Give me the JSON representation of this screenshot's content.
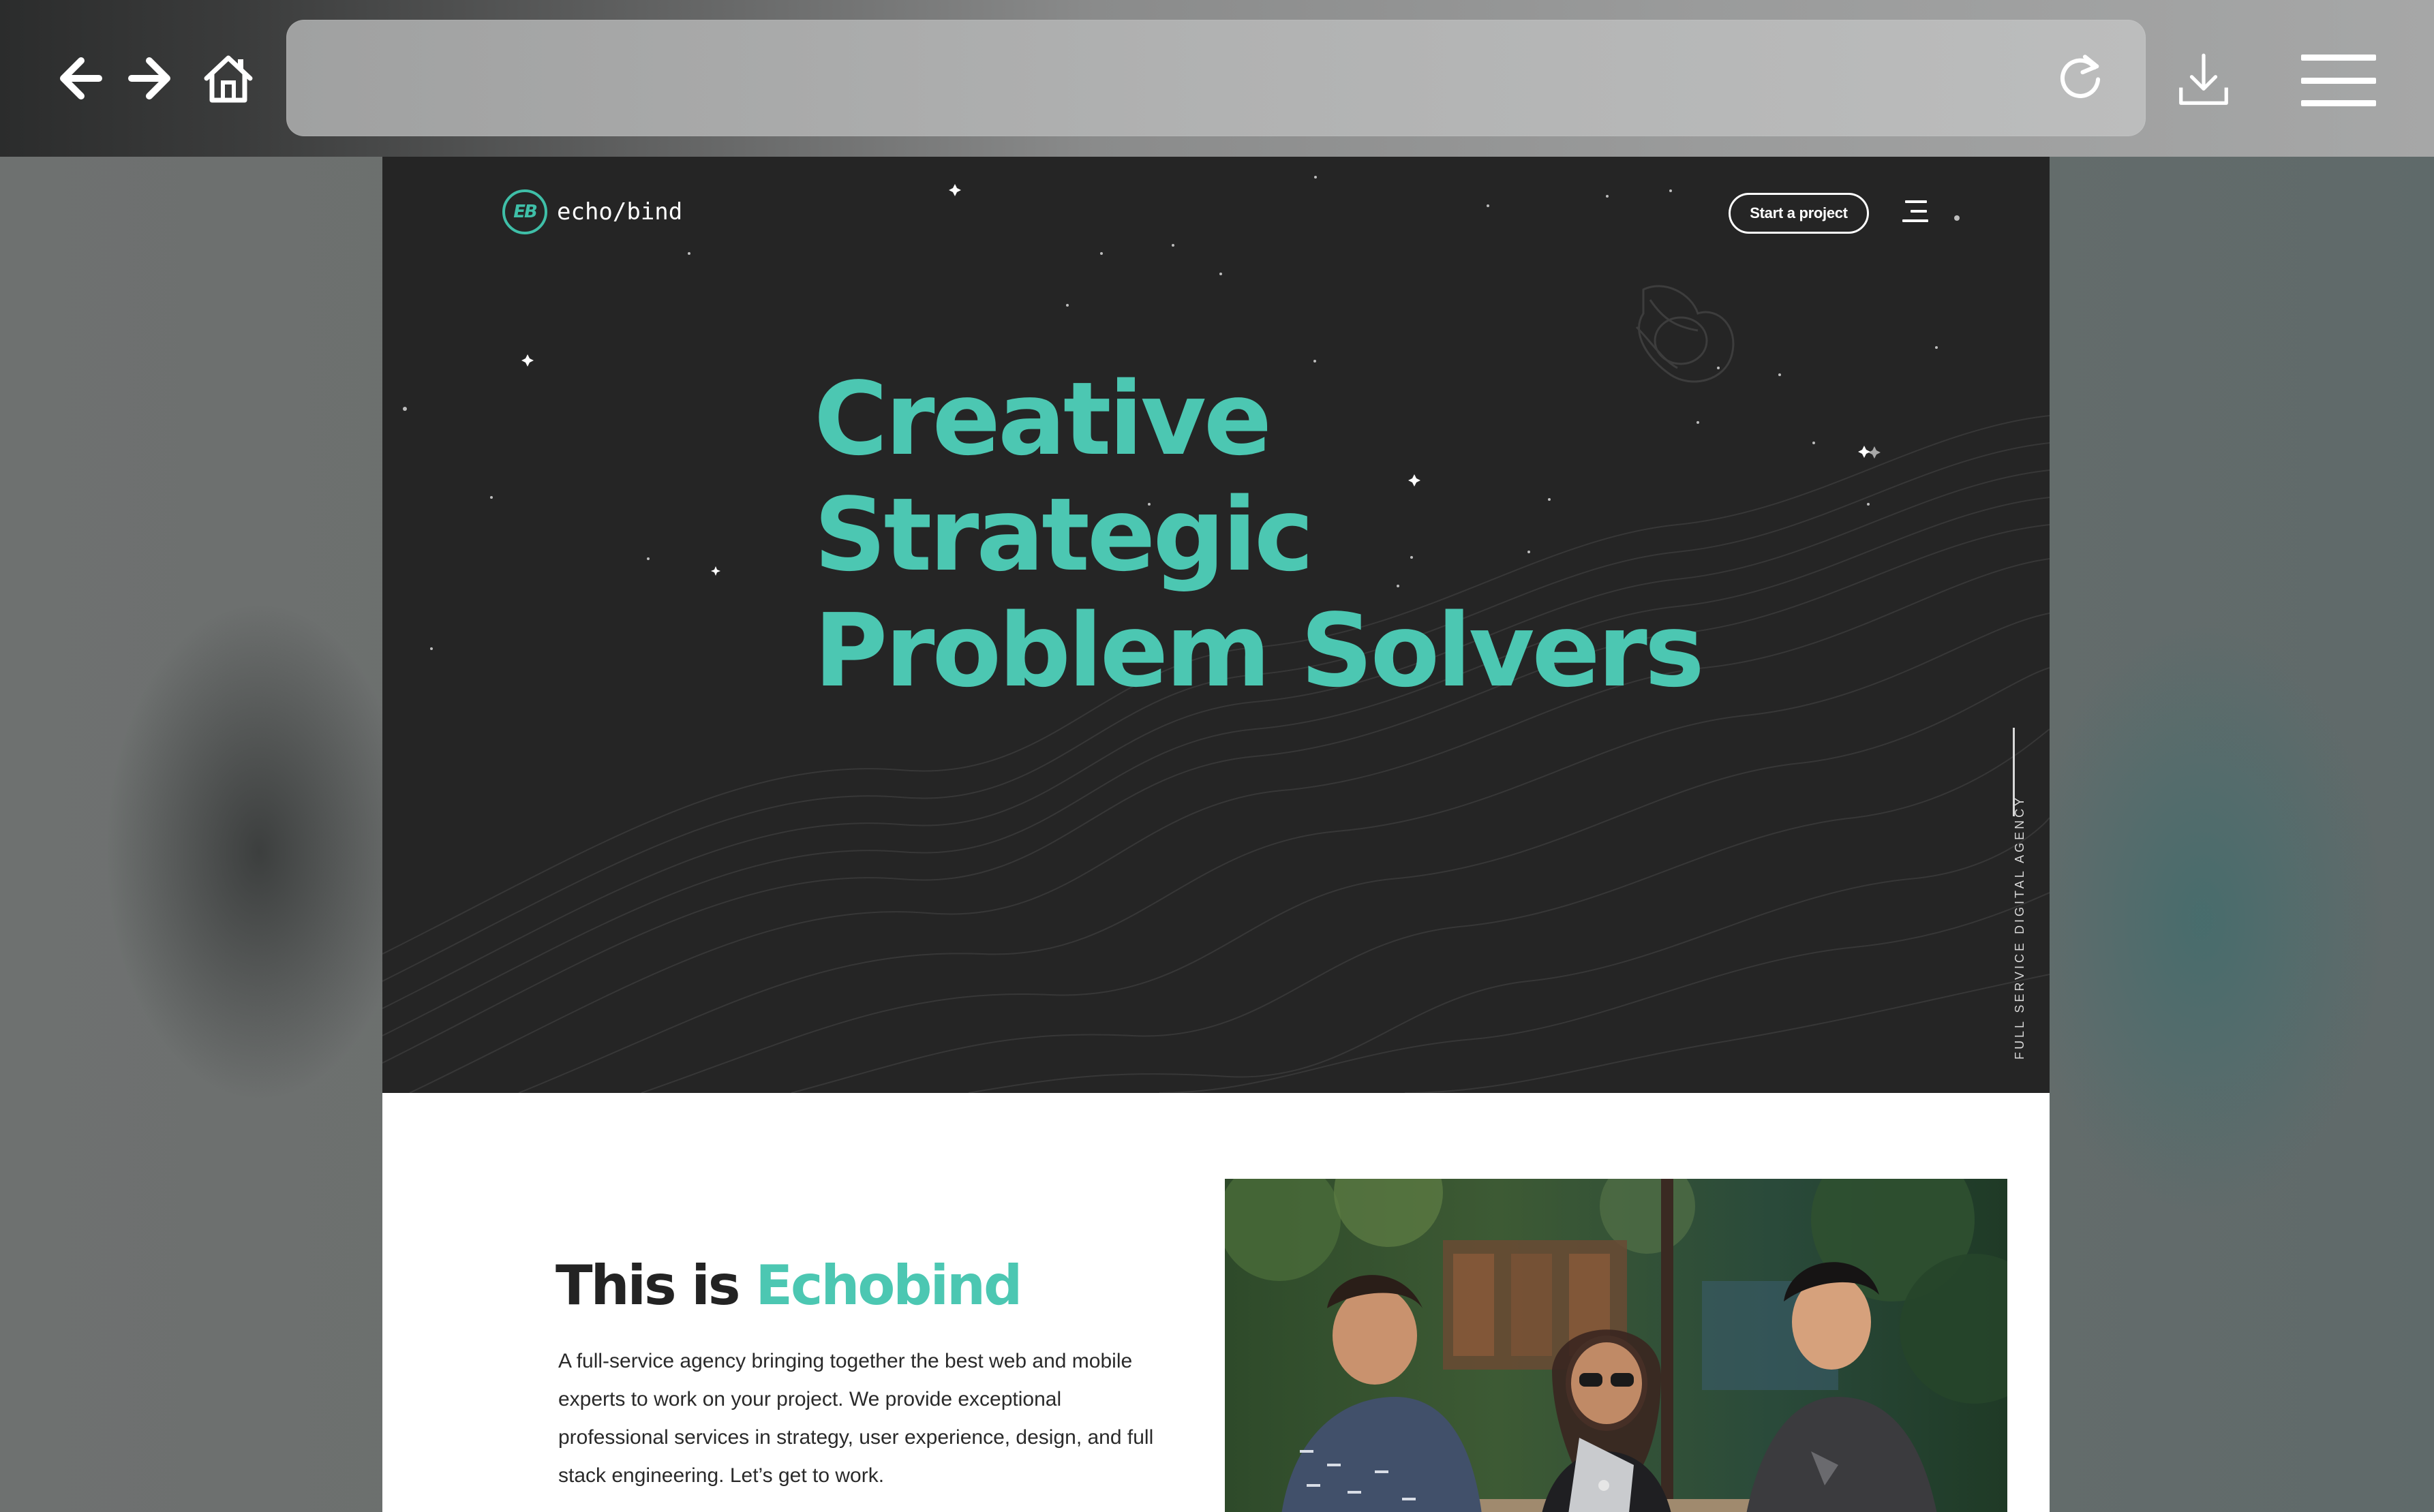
{
  "browser": {
    "address_value": "",
    "icons": {
      "back": "arrow-left-icon",
      "forward": "arrow-right-icon",
      "home": "home-icon",
      "reload": "reload-icon",
      "download": "download-icon",
      "menu": "hamburger-menu-icon"
    }
  },
  "site": {
    "logo_mark": "EB",
    "logo_text": "echo/bind",
    "cta_label": "Start a project",
    "menu_icon": "hamburger-menu-icon",
    "hero": {
      "line1": "Creative",
      "line2": "Strategic",
      "line3": "Problem Solvers"
    },
    "side_label": "FULL SERVICE DIGITAL AGENCY",
    "about": {
      "heading_prefix": "This is ",
      "heading_accent": "Echobind",
      "body": "A full-service agency bringing together the best web and mobile experts to work on your project. We provide exceptional professional services in strategy, user experience, design, and full stack engineering. Let’s get to work."
    },
    "colors": {
      "accent": "#4cc7b2",
      "hero_bg": "#252525",
      "page_bg": "#ffffff"
    }
  }
}
